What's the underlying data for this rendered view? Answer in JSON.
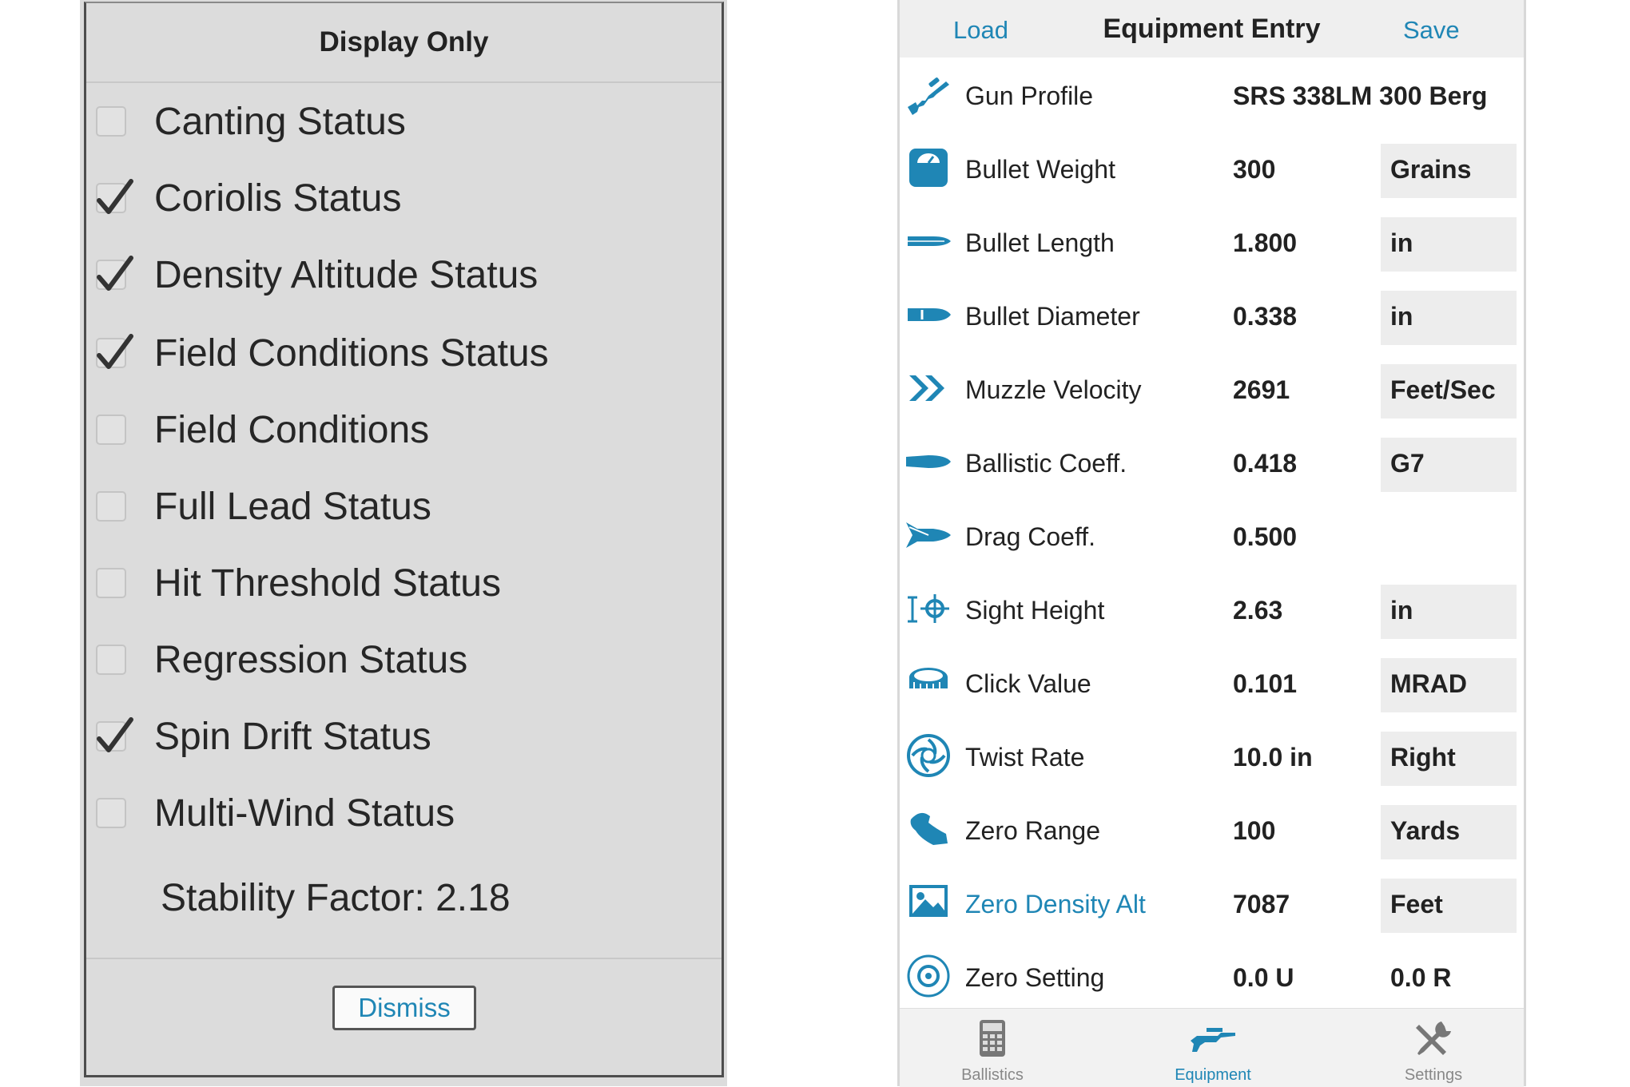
{
  "display_panel": {
    "title": "Display Only",
    "options": [
      {
        "label": "Canting Status",
        "checked": false
      },
      {
        "label": "Coriolis Status",
        "checked": true
      },
      {
        "label": "Density Altitude Status",
        "checked": true
      },
      {
        "label": "Field Conditions Status",
        "checked": true
      },
      {
        "label": "Field Conditions",
        "checked": false
      },
      {
        "label": "Full Lead Status",
        "checked": false
      },
      {
        "label": "Hit Threshold Status",
        "checked": false
      },
      {
        "label": "Regression Status",
        "checked": false
      },
      {
        "label": "Spin Drift Status",
        "checked": true
      },
      {
        "label": "Multi-Wind Status",
        "checked": false
      }
    ],
    "stability_factor": "Stability Factor: 2.18",
    "dismiss_label": "Dismiss"
  },
  "equipment": {
    "nav": {
      "load_label": "Load",
      "title": "Equipment Entry",
      "save_label": "Save"
    },
    "rows": [
      {
        "icon": "rifle-icon",
        "label": "Gun Profile",
        "value": "SRS 338LM 300 Berg",
        "unit": null
      },
      {
        "icon": "scale-icon",
        "label": "Bullet Weight",
        "value": "300",
        "unit": "Grains"
      },
      {
        "icon": "bullet-length-icon",
        "label": "Bullet Length",
        "value": "1.800",
        "unit": "in"
      },
      {
        "icon": "bullet-diameter-icon",
        "label": "Bullet Diameter",
        "value": "0.338",
        "unit": "in"
      },
      {
        "icon": "velocity-chevrons-icon",
        "label": "Muzzle Velocity",
        "value": "2691",
        "unit": "Feet/Sec"
      },
      {
        "icon": "ballistic-bullet-icon",
        "label": "Ballistic Coeff.",
        "value": "0.418",
        "unit": "G7"
      },
      {
        "icon": "drag-bullet-icon",
        "label": "Drag Coeff.",
        "value": "0.500",
        "unit": null
      },
      {
        "icon": "sight-height-icon",
        "label": "Sight Height",
        "value": "2.63",
        "unit": "in"
      },
      {
        "icon": "turret-icon",
        "label": "Click Value",
        "value": "0.101",
        "unit": "MRAD"
      },
      {
        "icon": "twist-icon",
        "label": "Twist Rate",
        "value": "10.0 in",
        "unit": "Right"
      },
      {
        "icon": "zero-range-icon",
        "label": "Zero Range",
        "value": "100",
        "unit": "Yards"
      },
      {
        "icon": "landscape-icon",
        "label": "Zero Density Alt",
        "value": "7087",
        "unit": "Feet",
        "link": true
      },
      {
        "icon": "target-icon",
        "label": "Zero Setting",
        "value": "0.0 U",
        "unit": "0.0 R"
      }
    ],
    "tabs": [
      {
        "label": "Ballistics",
        "icon": "calculator-icon",
        "active": false
      },
      {
        "label": "Equipment",
        "icon": "rifle-icon",
        "active": true
      },
      {
        "label": "Settings",
        "icon": "tools-icon",
        "active": false
      }
    ]
  },
  "colors": {
    "accent": "#1f86b5",
    "panel_bg": "#dcdcdc",
    "unit_bg": "#ededed"
  }
}
